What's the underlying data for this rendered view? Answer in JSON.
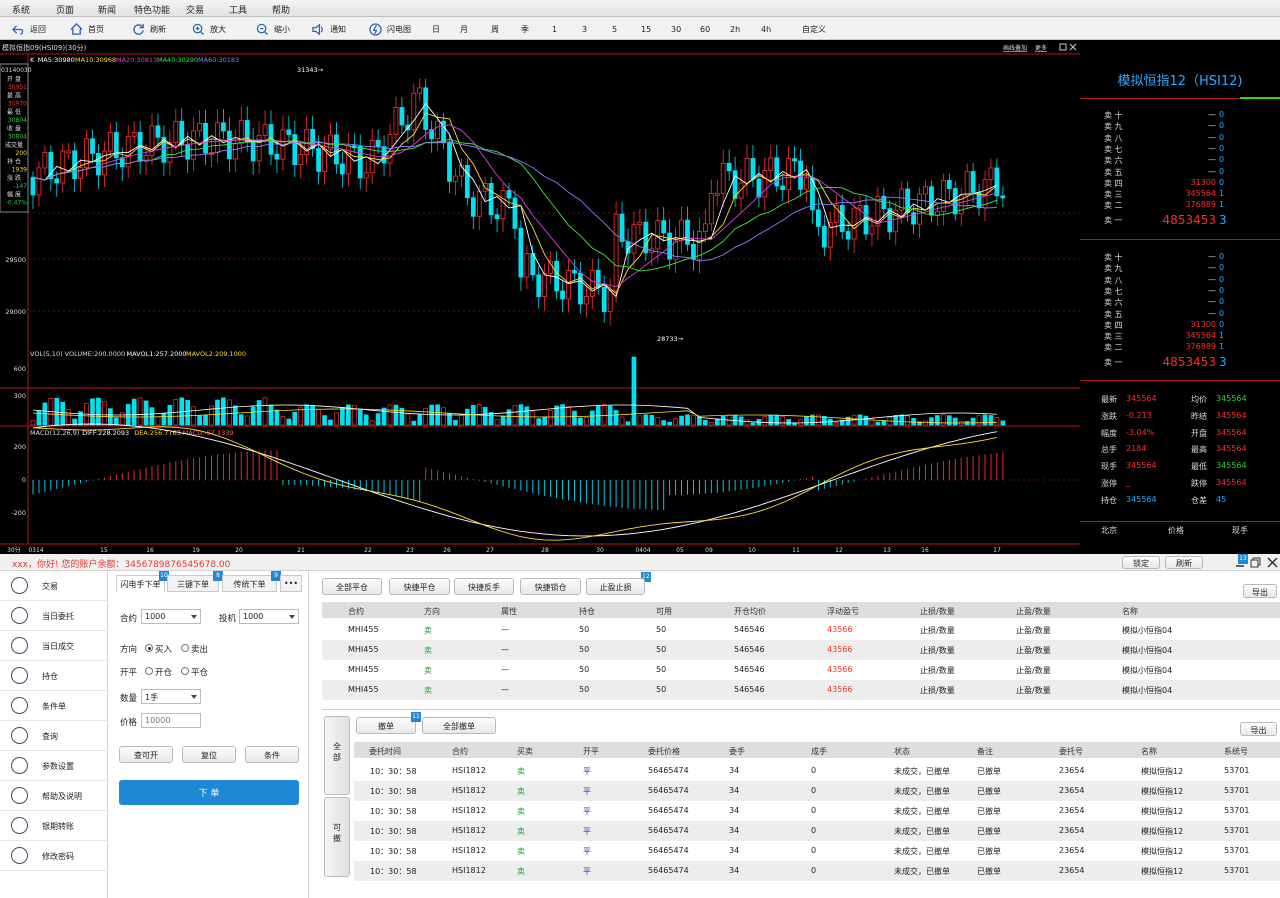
{
  "menu": [
    "系统",
    "页面",
    "新闻",
    "特色功能",
    "交易",
    "工具",
    "帮助"
  ],
  "toolbar": {
    "buttons": [
      {
        "label": "返回",
        "icon": "back-icon"
      },
      {
        "label": "首页",
        "icon": "home-icon"
      },
      {
        "label": "刷新",
        "icon": "refresh-icon"
      },
      {
        "label": "放大",
        "icon": "zoom-in-icon"
      },
      {
        "label": "缩小",
        "icon": "zoom-out-icon"
      },
      {
        "label": "通知",
        "icon": "speaker-icon"
      },
      {
        "label": "闪电图",
        "icon": "lightning-icon"
      }
    ],
    "periods": [
      "日",
      "月",
      "周",
      "季",
      "1",
      "3",
      "5",
      "15",
      "30",
      "60",
      "2h",
      "4h",
      "自定义"
    ]
  },
  "chart": {
    "title": "模拟恒指09(HSI09)(30分)",
    "top_links": [
      "画线叠加",
      "更多"
    ],
    "ma_legend": [
      {
        "text": "K",
        "color": "#ffffff"
      },
      {
        "text": "MA5:30980",
        "color": "#ffffff"
      },
      {
        "text": "MA10:30968",
        "color": "#ffdd33"
      },
      {
        "text": "MA20:30813",
        "color": "#e03ce0"
      },
      {
        "text": "MA40:30290",
        "color": "#3ee83e"
      },
      {
        "text": "MA60:30183",
        "color": "#8c7cff"
      }
    ],
    "info_box": {
      "date": "03140030",
      "items": [
        {
          "label": "开 盘",
          "value": "30951"
        },
        {
          "label": "最 高",
          "value": "30970"
        },
        {
          "label": "最 低",
          "value": "30804"
        },
        {
          "label": "收 盘",
          "value": "30804"
        },
        {
          "label": "成交量",
          "value": "200"
        },
        {
          "label": "持 仓",
          "value": "1939"
        },
        {
          "label": "涨 跌",
          "value": "-147"
        },
        {
          "label": "幅 度",
          "value": "-0.47%"
        }
      ]
    },
    "price_ticks": [
      "29500",
      "29000"
    ],
    "high_mark": "31343",
    "low_mark": "28733",
    "vol_legend": [
      {
        "text": "VOL(5,10) VOLUME:200.0000",
        "color": "#dddddd"
      },
      {
        "text": "MAVOL1:257.2000",
        "color": "#ffffff"
      },
      {
        "text": "MAVOL2:209.1000",
        "color": "#ffdd33"
      }
    ],
    "vol_ticks": [
      "600",
      "300"
    ],
    "macd_legend": [
      {
        "text": "MACD(12,26,9)",
        "color": "#dddddd"
      },
      {
        "text": "DIFF:228.2093",
        "color": "#ffffff"
      },
      {
        "text": "DEA:256.7763",
        "color": "#ffdd33"
      },
      {
        "text": "MACD:-57.1339",
        "color": "#ff6464"
      }
    ],
    "macd_ticks": [
      "200",
      "0",
      "-200"
    ],
    "x_ticks": [
      "30分",
      "0314",
      "15",
      "16",
      "19",
      "20",
      "21",
      "22",
      "23",
      "26",
      "27",
      "28",
      "30",
      "0404",
      "05",
      "09",
      "10",
      "11",
      "12",
      "13",
      "16",
      "17"
    ]
  },
  "quote": {
    "title": "模拟恒指12（HSI12)",
    "sell_book_1": [
      {
        "label": "卖 十",
        "price": "—",
        "vol": "0"
      },
      {
        "label": "卖 九",
        "price": "—",
        "vol": "0"
      },
      {
        "label": "卖 八",
        "price": "—",
        "vol": "0"
      },
      {
        "label": "卖 七",
        "price": "—",
        "vol": "0"
      },
      {
        "label": "卖 六",
        "price": "—",
        "vol": "0"
      },
      {
        "label": "卖 五",
        "price": "—",
        "vol": "0"
      },
      {
        "label": "卖 四",
        "price": "31300",
        "vol": "0"
      },
      {
        "label": "卖 三",
        "price": "345564",
        "vol": "1"
      },
      {
        "label": "卖 二",
        "price": "376889",
        "vol": "1"
      },
      {
        "label": "卖 一",
        "price": "4853453",
        "vol": "3"
      }
    ],
    "sell_book_2": [
      {
        "label": "卖 十",
        "price": "—",
        "vol": "0"
      },
      {
        "label": "卖 九",
        "price": "—",
        "vol": "0"
      },
      {
        "label": "卖 八",
        "price": "—",
        "vol": "0"
      },
      {
        "label": "卖 七",
        "price": "—",
        "vol": "0"
      },
      {
        "label": "卖 六",
        "price": "—",
        "vol": "0"
      },
      {
        "label": "卖 五",
        "price": "—",
        "vol": "0"
      },
      {
        "label": "卖 四",
        "price": "31300",
        "vol": "0"
      },
      {
        "label": "卖 三",
        "price": "345564",
        "vol": "1"
      },
      {
        "label": "卖 二",
        "price": "376889",
        "vol": "1"
      },
      {
        "label": "卖 一",
        "price": "4853453",
        "vol": "3"
      }
    ],
    "stats": [
      {
        "l1": "最新",
        "v1": "345564",
        "c1": "#ff2a2a",
        "l2": "均价",
        "v2": "345564",
        "c2": "#2bd02b"
      },
      {
        "l1": "涨跌",
        "v1": "-0.213",
        "c1": "#ff2a2a",
        "l2": "昨结",
        "v2": "345564",
        "c2": "#ff2a2a"
      },
      {
        "l1": "幅度",
        "v1": "-3.04%",
        "c1": "#ff2a2a",
        "l2": "开盘",
        "v2": "345564",
        "c2": "#ff2a2a"
      },
      {
        "l1": "总手",
        "v1": "2184",
        "c1": "#ff2a2a",
        "l2": "最高",
        "v2": "345564",
        "c2": "#ff2a2a"
      },
      {
        "l1": "现手",
        "v1": "345564",
        "c1": "#ff2a2a",
        "l2": "最低",
        "v2": "345564",
        "c2": "#2bd02b"
      },
      {
        "l1": "涨停",
        "v1": "_",
        "c1": "#ff2a2a",
        "l2": "跌停",
        "v2": "345564",
        "c2": "#ff2a2a"
      },
      {
        "l1": "持仓",
        "v1": "345564",
        "c1": "#29a8ff",
        "l2": "仓差",
        "v2": "45",
        "c2": "#29a8ff"
      }
    ],
    "footer": [
      "北京",
      "价格",
      "现手"
    ]
  },
  "status": {
    "message": "xxx，你好!  您的账户余额：3456789876545678.00",
    "lock": "锁定",
    "refresh": "刷新",
    "badge": "13"
  },
  "nav": [
    {
      "label": "交易",
      "icon": "yen-icon"
    },
    {
      "label": "当日委托",
      "icon": "entrust-icon"
    },
    {
      "label": "当日成交",
      "icon": "gavel-icon"
    },
    {
      "label": "持仓",
      "icon": "target-icon"
    },
    {
      "label": "条件单",
      "icon": "filter-icon"
    },
    {
      "label": "查询",
      "icon": "search-doc-icon"
    },
    {
      "label": "参数设置",
      "icon": "gear-icon"
    },
    {
      "label": "帮助及说明",
      "icon": "help-icon"
    },
    {
      "label": "银期转账",
      "icon": "transfer-icon"
    },
    {
      "label": "修改密码",
      "icon": "lock-icon"
    }
  ],
  "order": {
    "tabs": [
      {
        "label": "闪电手下单",
        "badge": "10"
      },
      {
        "label": "三键下单",
        "badge": "8"
      },
      {
        "label": "传统下单",
        "badge": "9"
      },
      {
        "label": "•••",
        "badge": ""
      }
    ],
    "contract_label": "合约",
    "contract_value": "1000",
    "hedge_label": "投机",
    "hedge_value": "1000",
    "direction_label": "方向",
    "buy": "买入",
    "sell": "卖出",
    "openclose_label": "开平",
    "open": "开仓",
    "close": "平仓",
    "qty_label": "数量",
    "qty_value": "1手",
    "price_label": "价格",
    "price_placeholder": "10000",
    "btn_check": "查可开",
    "btn_reset": "复位",
    "btn_cond": "条件",
    "submit": "下 单"
  },
  "positions": {
    "actions": [
      "全部平仓",
      "快捷平仓",
      "快捷反手",
      "快捷锁仓",
      "止盈止损"
    ],
    "badge": "12",
    "export": "导出",
    "headers": [
      "合约",
      "方向",
      "属性",
      "持仓",
      "可用",
      "开仓均价",
      "浮动盈亏",
      "止损/数量",
      "止盈/数量",
      "名称"
    ],
    "rows": [
      [
        "MHI455",
        "卖",
        "—",
        "50",
        "50",
        "546546",
        "43566",
        "止损/数量",
        "止盈/数量",
        "模拟小恒指04"
      ],
      [
        "MHI455",
        "卖",
        "—",
        "50",
        "50",
        "546546",
        "43566",
        "止损/数量",
        "止盈/数量",
        "模拟小恒指04"
      ],
      [
        "MHI455",
        "卖",
        "—",
        "50",
        "50",
        "546546",
        "43566",
        "止损/数量",
        "止盈/数量",
        "模拟小恒指04"
      ],
      [
        "MHI455",
        "卖",
        "—",
        "50",
        "50",
        "546546",
        "43566",
        "止损/数量",
        "止盈/数量",
        "模拟小恒指04"
      ]
    ]
  },
  "orders": {
    "side_tabs": [
      "全\n部",
      "可\n撤"
    ],
    "cancel": "撤单",
    "cancel_all": "全部撤单",
    "badge": "11",
    "export": "导出",
    "headers": [
      "委托时间",
      "合约",
      "买卖",
      "开平",
      "委托价格",
      "委手",
      "成手",
      "状态",
      "备注",
      "委托号",
      "名称",
      "系统号"
    ],
    "rows": [
      [
        "10：30：58",
        "HSI1812",
        "卖",
        "平",
        "56465474",
        "34",
        "0",
        "未成交，已撤单",
        "已撤单",
        "23654",
        "模拟恒指12",
        "53701"
      ],
      [
        "10：30：58",
        "HSI1812",
        "卖",
        "平",
        "56465474",
        "34",
        "0",
        "未成交，已撤单",
        "已撤单",
        "23654",
        "模拟恒指12",
        "53701"
      ],
      [
        "10：30：58",
        "HSI1812",
        "卖",
        "平",
        "56465474",
        "34",
        "0",
        "未成交，已撤单",
        "已撤单",
        "23654",
        "模拟恒指12",
        "53701"
      ],
      [
        "10：30：58",
        "HSI1812",
        "卖",
        "平",
        "56465474",
        "34",
        "0",
        "未成交，已撤单",
        "已撤单",
        "23654",
        "模拟恒指12",
        "53701"
      ],
      [
        "10：30：58",
        "HSI1812",
        "卖",
        "平",
        "56465474",
        "34",
        "0",
        "未成交，已撤单",
        "已撤单",
        "23654",
        "模拟恒指12",
        "53701"
      ],
      [
        "10：30：58",
        "HSI1812",
        "卖",
        "平",
        "56465474",
        "34",
        "0",
        "未成交，已撤单",
        "已撤单",
        "23654",
        "模拟恒指12",
        "53701"
      ]
    ]
  },
  "colors": {
    "up": "#ff3030",
    "down": "#00e0f0",
    "panel_border": "#b31414",
    "accent": "#1e88d5"
  }
}
